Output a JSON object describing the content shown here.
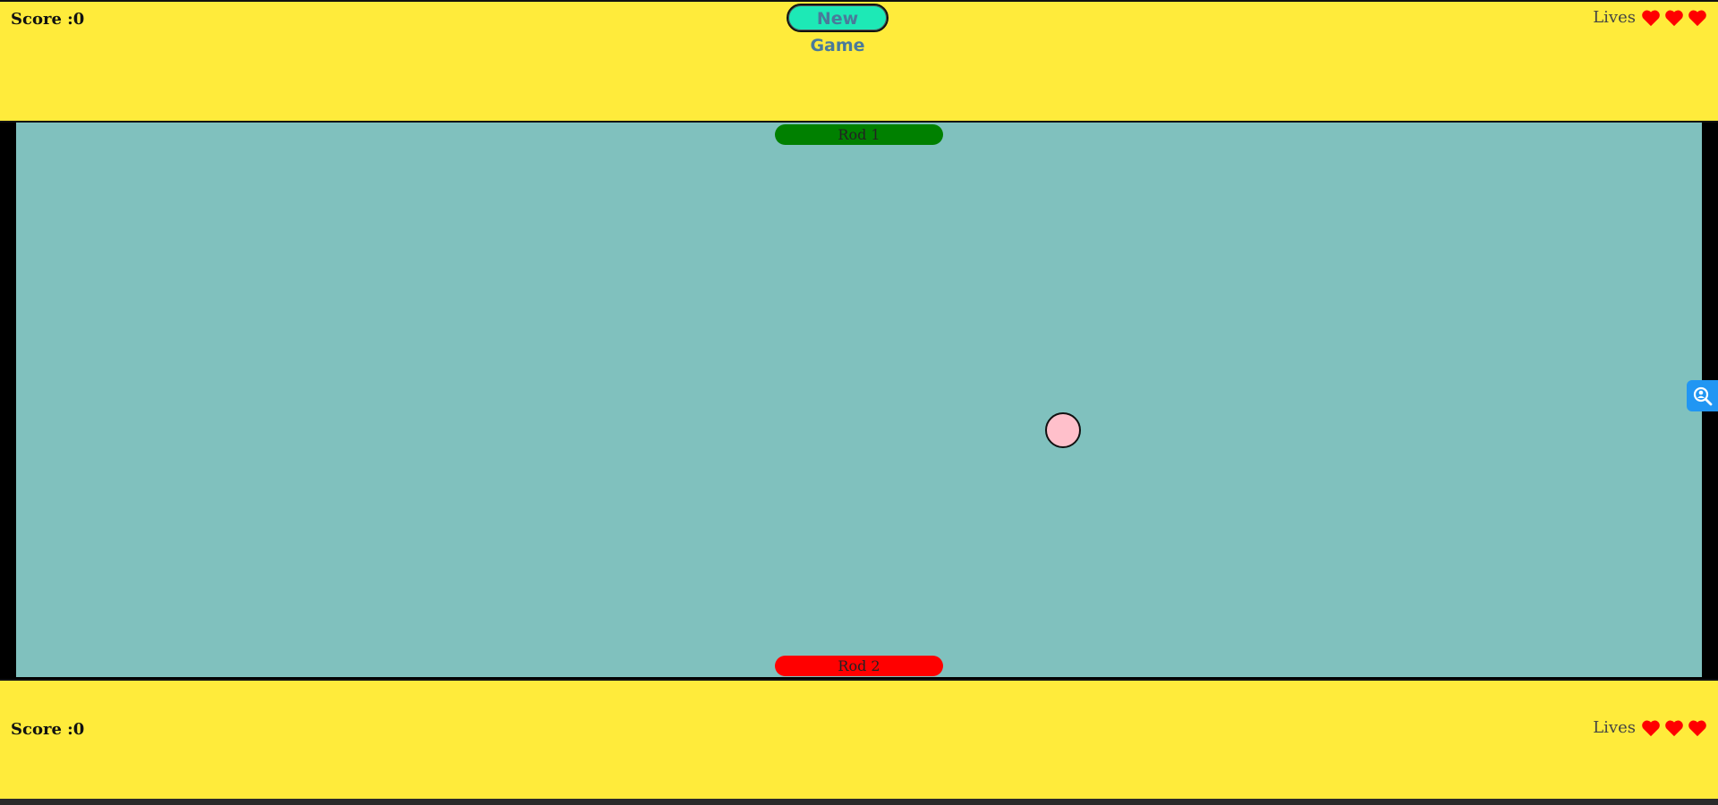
{
  "top_player": {
    "score_label": "Score :0",
    "lives_label": "Lives",
    "lives": 3
  },
  "bottom_player": {
    "score_label": "Score :0",
    "lives_label": "Lives",
    "lives": 3
  },
  "new_game_label": "New Game",
  "rods": {
    "rod1_label": "Rod 1",
    "rod2_label": "Rod 2"
  },
  "colors": {
    "panel_bg": "#ffeb3b",
    "field_bg": "#80c1be",
    "rod1": "#008000",
    "rod2": "#ff0000",
    "ball": "#ffc0cb",
    "button": "#1de9b6",
    "heart": "#ff0000"
  },
  "icons": {
    "heart": "heart-icon",
    "side_tool": "search-person-icon"
  }
}
